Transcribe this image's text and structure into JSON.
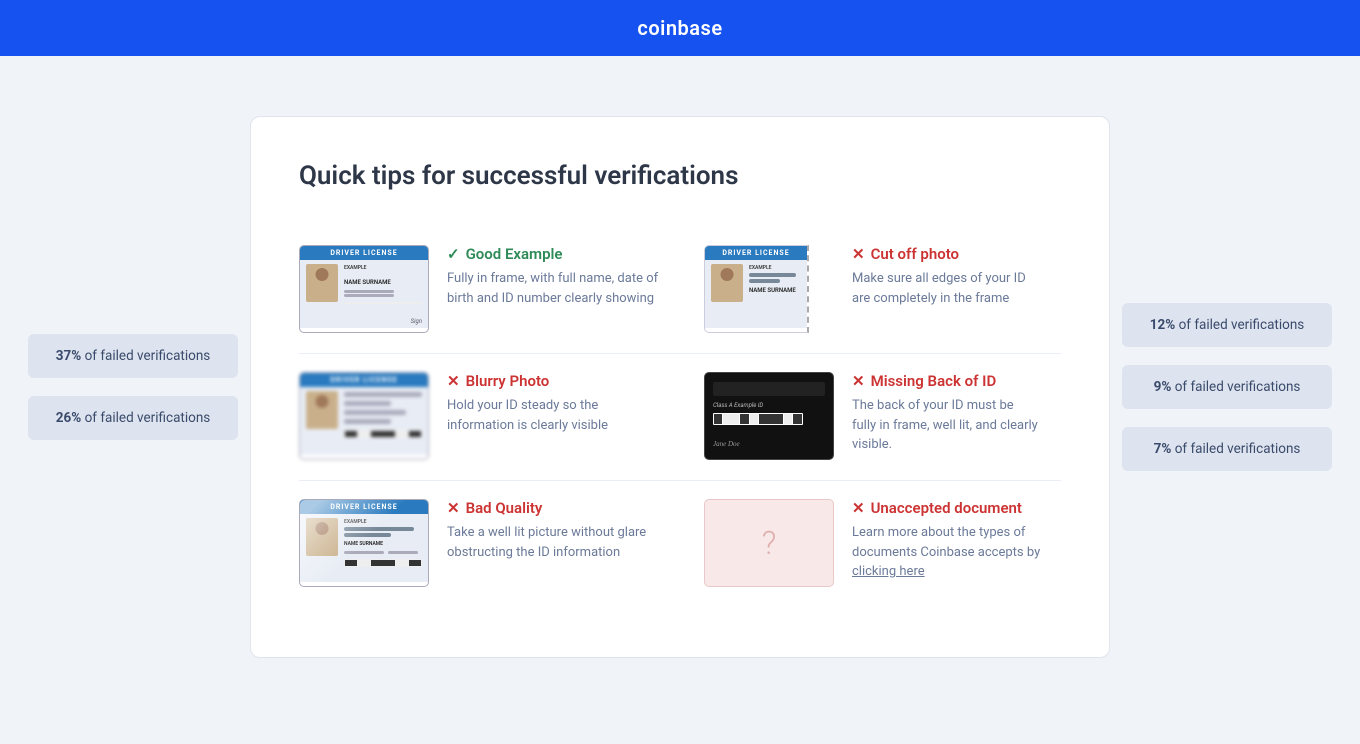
{
  "header": {
    "logo": "coinbase"
  },
  "page": {
    "title": "Quick tips for successful verifications"
  },
  "left_badges": [
    {
      "percent": "37%",
      "label": "of failed verifications"
    },
    {
      "percent": "26%",
      "label": "of failed verifications"
    }
  ],
  "right_badges": [
    {
      "percent": "12%",
      "label": "of failed verifications"
    },
    {
      "percent": "9%",
      "label": "of failed verifications"
    },
    {
      "percent": "7%",
      "label": "of failed verifications"
    }
  ],
  "tips": [
    {
      "id": "good-example",
      "type": "good",
      "flag_icon": "✓",
      "label": "Good Example",
      "desc": "Fully in frame, with full name, date of birth and ID number clearly showing"
    },
    {
      "id": "cut-off-photo",
      "type": "bad",
      "flag_icon": "✕",
      "label": "Cut off photo",
      "desc": "Make sure all edges of your ID are completely in the frame"
    },
    {
      "id": "blurry-photo",
      "type": "bad",
      "flag_icon": "✕",
      "label": "Blurry Photo",
      "desc": "Hold your ID steady so the information is clearly visible"
    },
    {
      "id": "missing-back",
      "type": "bad",
      "flag_icon": "✕",
      "label": "Missing Back of ID",
      "desc": "The back of your ID must be fully in frame, well lit, and clearly visible."
    },
    {
      "id": "bad-quality",
      "type": "bad",
      "flag_icon": "✕",
      "label": "Bad Quality",
      "desc": "Take a well lit picture without glare obstructing the ID information"
    },
    {
      "id": "unaccepted-document",
      "type": "bad",
      "flag_icon": "✕",
      "label": "Unaccepted document",
      "desc": "Learn more about the types of documents Coinbase accepts by",
      "link_text": "clicking here",
      "link_href": "#"
    }
  ]
}
